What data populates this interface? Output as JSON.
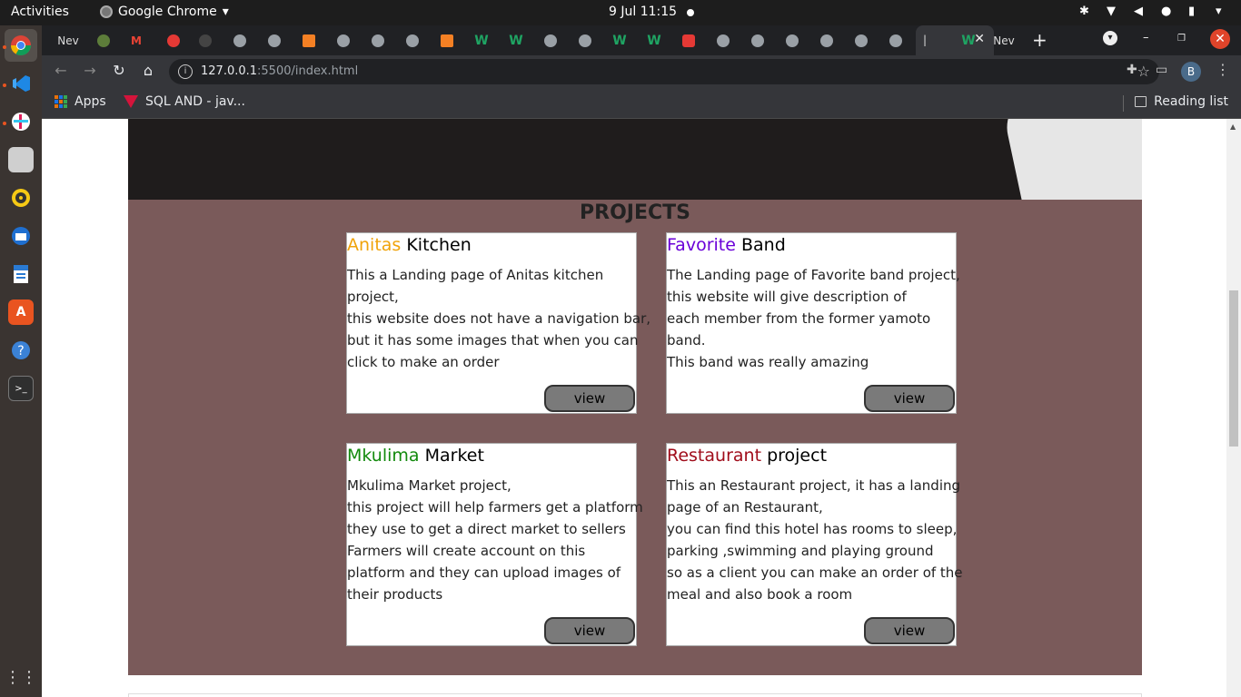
{
  "system": {
    "activities": "Activities",
    "app_name": "Google Chrome",
    "clock": "9 Jul  11:15"
  },
  "browser": {
    "first_tab_label": "Nev",
    "active_tab_label": "|",
    "last_tab_label": "Nev",
    "url_host": "127.0.0.1",
    "url_rest": ":5500/index.html",
    "profile_initial": "B",
    "bookmarks": {
      "apps": "Apps",
      "sql": "SQL AND - jav...",
      "reading_list": "Reading list"
    }
  },
  "page": {
    "section_title": "PROJECTS",
    "colors": {
      "section_bg": "#7a5a5a",
      "anitas": "#f0a30a",
      "favorite": "#6a00d8",
      "mkulima": "#138a0d",
      "restaurant": "#a00d1b"
    },
    "projects": [
      {
        "highlight": "Anitas",
        "rest": " Kitchen",
        "lines": [
          "This a Landing page of Anitas kitchen",
          "project,",
          "this website does not have a navigation bar,",
          "but it has some images that when you can",
          "click to make an order"
        ],
        "button": "view"
      },
      {
        "highlight": "Favorite",
        "rest": " Band",
        "lines": [
          "The Landing page of Favorite band project,",
          "this website will give description of",
          "each member from the former yamoto",
          "band.",
          "This band was really amazing"
        ],
        "button": "view"
      },
      {
        "highlight": "Mkulima",
        "rest": " Market",
        "lines": [
          "Mkulima Market project,",
          "this project will help farmers get a platform",
          "they use to get a direct market to sellers",
          "Farmers will create account on this",
          "platform and they can upload images of",
          "their products"
        ],
        "button": "view"
      },
      {
        "highlight": "Restaurant",
        "rest": " project",
        "lines": [
          "This an Restaurant project, it has a landing",
          "page of an Restaurant,",
          "you can find this hotel has rooms to sleep,",
          "parking ,swimming and playing ground",
          "so as a client you can make an order of the",
          "meal and also book a room"
        ],
        "button": "view"
      }
    ]
  }
}
